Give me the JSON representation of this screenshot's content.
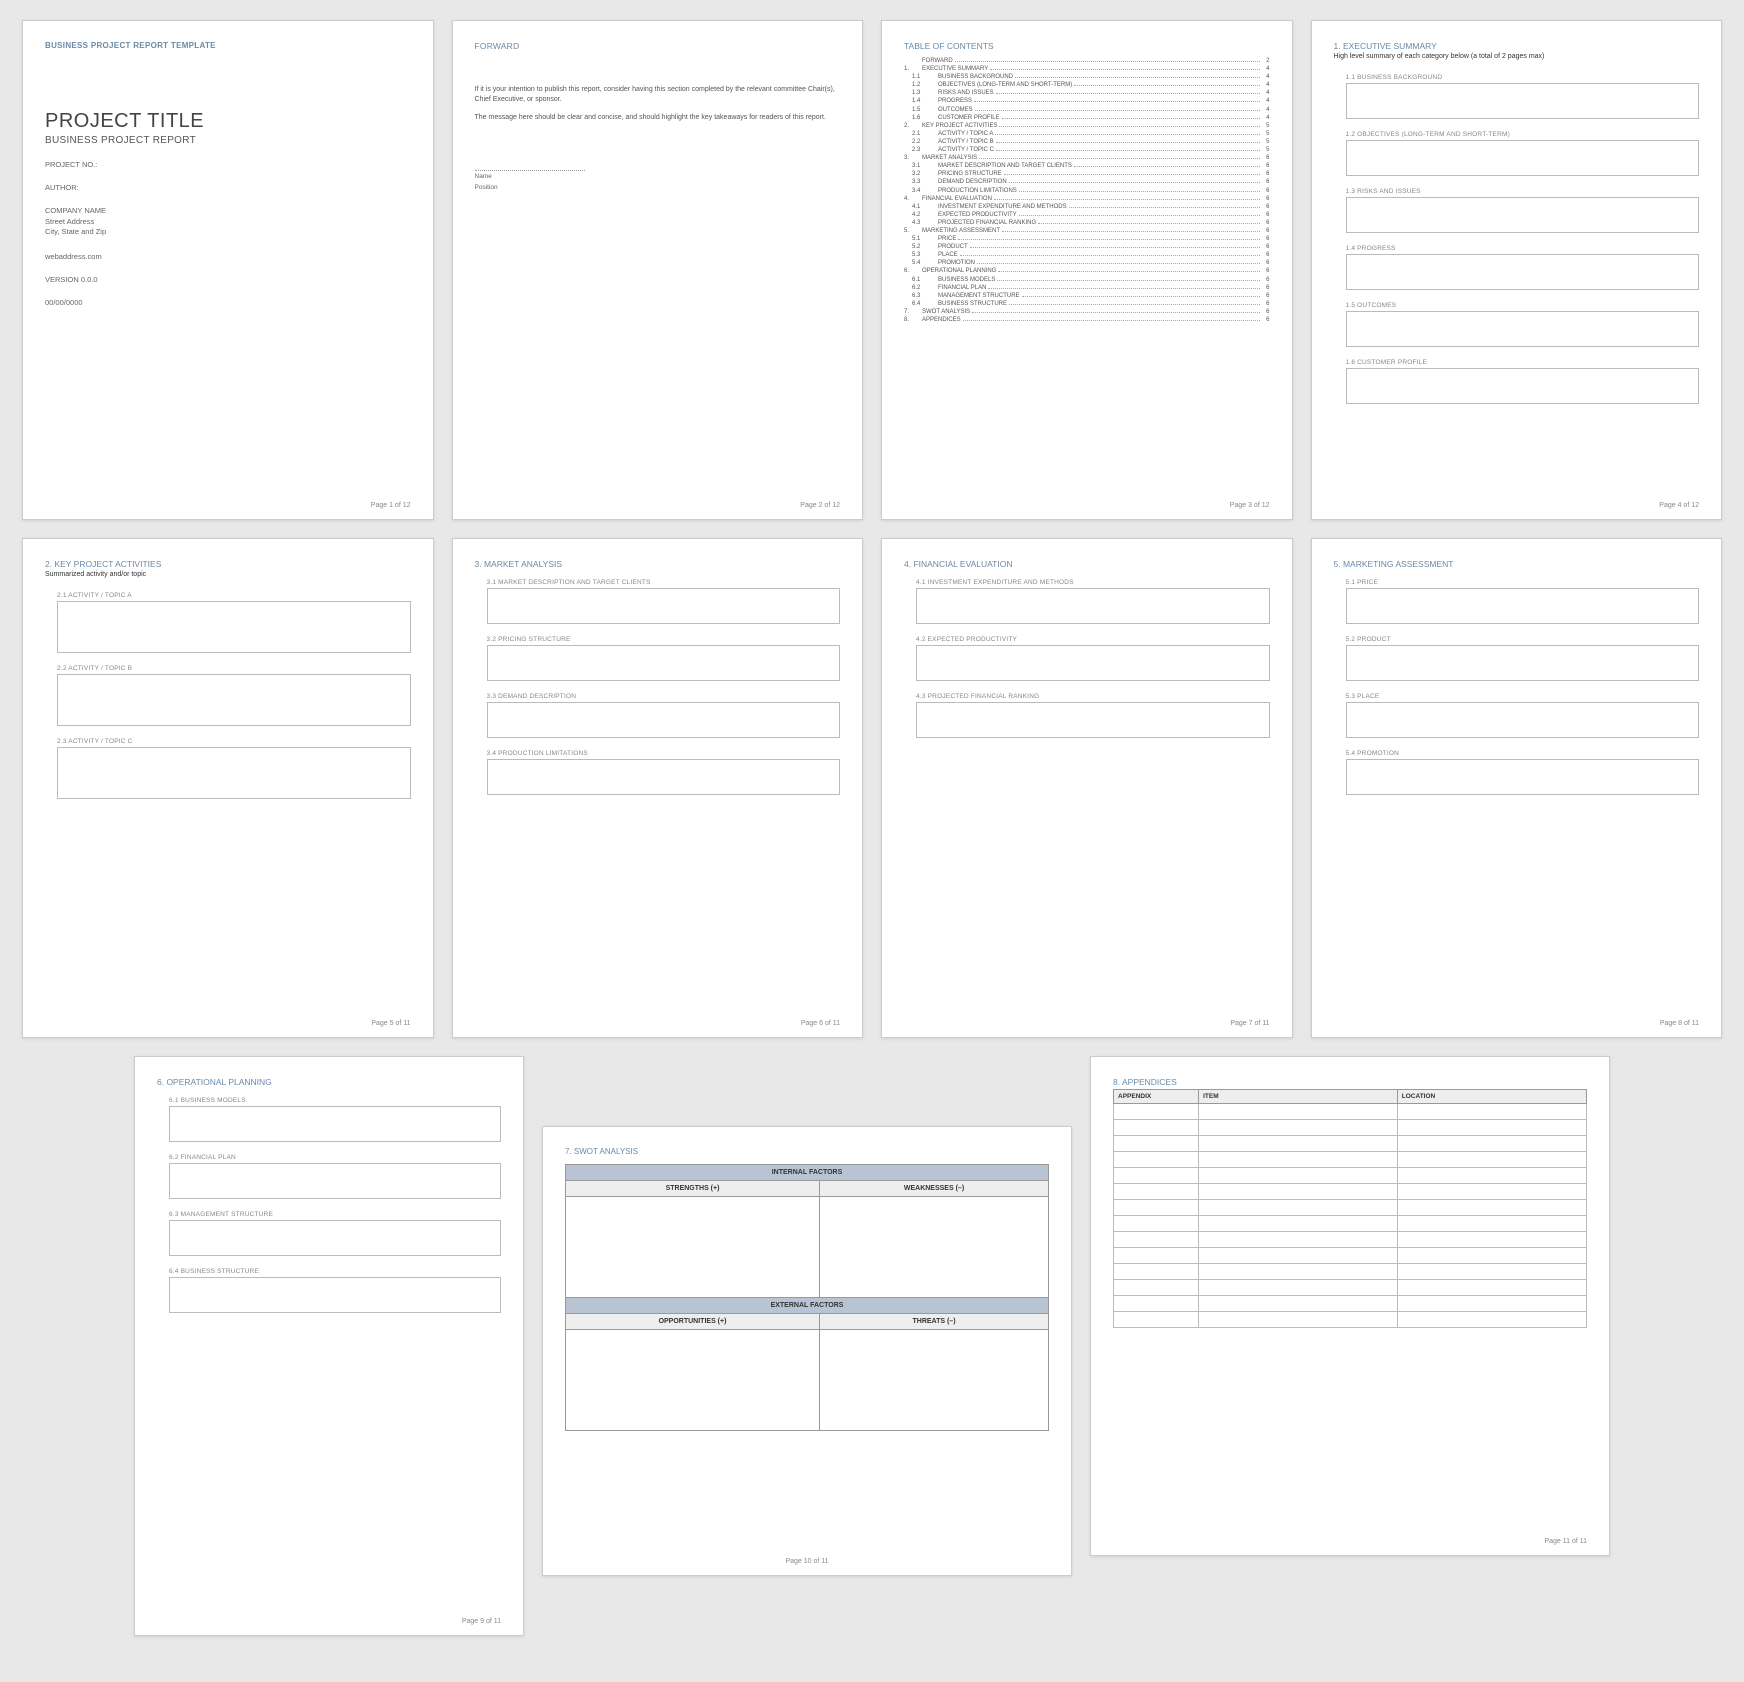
{
  "templateHeader": "BUSINESS PROJECT REPORT TEMPLATE",
  "cover": {
    "title": "PROJECT TITLE",
    "subtitle": "BUSINESS PROJECT REPORT",
    "projectNo": "PROJECT NO.:",
    "author": "AUTHOR:",
    "company": "COMPANY NAME",
    "street": "Street Address",
    "cityStateZip": "City, State and Zip",
    "web": "webaddress.com",
    "version": "VERSION 0.0.0",
    "date": "00/00/0000"
  },
  "forward": {
    "title": "FORWARD",
    "para1": "If it is your intention to publish this report, consider having this section completed by the relevant committee Chair(s), Chief Executive, or sponsor.",
    "para2": "The message here should be clear and concise, and should highlight the key takeaways for readers of this report.",
    "nameLabel": "Name",
    "positionLabel": "Position"
  },
  "toc": {
    "title": "TABLE OF CONTENTS",
    "items": [
      {
        "n": "",
        "t": "FORWARD",
        "p": "2",
        "sub": false
      },
      {
        "n": "1.",
        "t": "EXECUTIVE SUMMARY",
        "p": "4",
        "sub": false
      },
      {
        "n": "1.1",
        "t": "BUSINESS BACKGROUND",
        "p": "4",
        "sub": true
      },
      {
        "n": "1.2",
        "t": "OBJECTIVES (LONG-TERM AND SHORT-TERM)",
        "p": "4",
        "sub": true
      },
      {
        "n": "1.3",
        "t": "RISKS AND ISSUES",
        "p": "4",
        "sub": true
      },
      {
        "n": "1.4",
        "t": "PROGRESS",
        "p": "4",
        "sub": true
      },
      {
        "n": "1.5",
        "t": "OUTCOMES",
        "p": "4",
        "sub": true
      },
      {
        "n": "1.6",
        "t": "CUSTOMER PROFILE",
        "p": "4",
        "sub": true
      },
      {
        "n": "2.",
        "t": "KEY PROJECT ACTIVITIES",
        "p": "5",
        "sub": false
      },
      {
        "n": "2.1",
        "t": "ACTIVITY / TOPIC A",
        "p": "5",
        "sub": true
      },
      {
        "n": "2.2",
        "t": "ACTIVITY / TOPIC B",
        "p": "5",
        "sub": true
      },
      {
        "n": "2.3",
        "t": "ACTIVITY / TOPIC C",
        "p": "5",
        "sub": true
      },
      {
        "n": "3.",
        "t": "MARKET ANALYSIS",
        "p": "6",
        "sub": false
      },
      {
        "n": "3.1",
        "t": "MARKET DESCRIPTION AND TARGET CLIENTS",
        "p": "6",
        "sub": true
      },
      {
        "n": "3.2",
        "t": "PRICING STRUCTURE",
        "p": "6",
        "sub": true
      },
      {
        "n": "3.3",
        "t": "DEMAND DESCRIPTION",
        "p": "6",
        "sub": true
      },
      {
        "n": "3.4",
        "t": "PRODUCTION LIMITATIONS",
        "p": "6",
        "sub": true
      },
      {
        "n": "4.",
        "t": "FINANCIAL EVALUATION",
        "p": "6",
        "sub": false
      },
      {
        "n": "4.1",
        "t": "INVESTMENT EXPENDITURE AND METHODS",
        "p": "6",
        "sub": true
      },
      {
        "n": "4.2",
        "t": "EXPECTED PRODUCTIVITY",
        "p": "6",
        "sub": true
      },
      {
        "n": "4.3",
        "t": "PROJECTED FINANCIAL RANKING",
        "p": "6",
        "sub": true
      },
      {
        "n": "5.",
        "t": "MARKETING ASSESSMENT",
        "p": "6",
        "sub": false
      },
      {
        "n": "5.1",
        "t": "PRICE",
        "p": "6",
        "sub": true
      },
      {
        "n": "5.2",
        "t": "PRODUCT",
        "p": "6",
        "sub": true
      },
      {
        "n": "5.3",
        "t": "PLACE",
        "p": "6",
        "sub": true
      },
      {
        "n": "5.4",
        "t": "PROMOTION",
        "p": "6",
        "sub": true
      },
      {
        "n": "6.",
        "t": "OPERATIONAL PLANNING",
        "p": "6",
        "sub": false
      },
      {
        "n": "6.1",
        "t": "BUSINESS MODELS",
        "p": "6",
        "sub": true
      },
      {
        "n": "6.2",
        "t": "FINANCIAL PLAN",
        "p": "6",
        "sub": true
      },
      {
        "n": "6.3",
        "t": "MANAGEMENT STRUCTURE",
        "p": "6",
        "sub": true
      },
      {
        "n": "6.4",
        "t": "BUSINESS STRUCTURE",
        "p": "6",
        "sub": true
      },
      {
        "n": "7.",
        "t": "SWOT ANALYSIS",
        "p": "6",
        "sub": false
      },
      {
        "n": "8.",
        "t": "APPENDICES",
        "p": "6",
        "sub": false
      }
    ]
  },
  "exec": {
    "title": "1. EXECUTIVE SUMMARY",
    "desc": "High level summary of each category below (a total of 2 pages max)",
    "s1": "1.1   BUSINESS BACKGROUND",
    "s2": "1.2   OBJECTIVES (LONG-TERM AND SHORT-TERM)",
    "s3": "1.3   RISKS AND ISSUES",
    "s4": "1.4   PROGRESS",
    "s5": "1.5   OUTCOMES",
    "s6": "1.6   CUSTOMER PROFILE"
  },
  "key": {
    "title": "2. KEY PROJECT ACTIVITIES",
    "desc": "Summarized activity and/or topic",
    "s1": "2.1   ACTIVITY / TOPIC A",
    "s2": "2.2   ACTIVITY / TOPIC B",
    "s3": "2.3   ACTIVITY / TOPIC C"
  },
  "market": {
    "title": "3. MARKET ANALYSIS",
    "s1": "3.1   MARKET DESCRIPTION AND TARGET CLIENTS",
    "s2": "3.2   PRICING STRUCTURE",
    "s3": "3.3   DEMAND DESCRIPTION",
    "s4": "3.4   PRODUCTION LIMITATIONS"
  },
  "fin": {
    "title": "4. FINANCIAL EVALUATION",
    "s1": "4.1   INVESTMENT EXPENDITURE AND METHODS",
    "s2": "4.2   EXPECTED PRODUCTIVITY",
    "s3": "4.3   PROJECTED FINANCIAL RANKING"
  },
  "mkt": {
    "title": "5. MARKETING ASSESSMENT",
    "s1": "5.1   PRICE",
    "s2": "5.2   PRODUCT",
    "s3": "5.3   PLACE",
    "s4": "5.4   PROMOTION"
  },
  "ops": {
    "title": "6. OPERATIONAL PLANNING",
    "s1": "6.1   BUSINESS MODELS",
    "s2": "6.2   FINANCIAL PLAN",
    "s3": "6.3   MANAGEMENT STRUCTURE",
    "s4": "6.4   BUSINESS STRUCTURE"
  },
  "swot": {
    "title": "7. SWOT ANALYSIS",
    "internal": "INTERNAL FACTORS",
    "external": "EXTERNAL FACTORS",
    "strengths": "STRENGTHS (+)",
    "weaknesses": "WEAKNESSES (–)",
    "opportunities": "OPPORTUNITIES (+)",
    "threats": "THREATS (–)"
  },
  "apx": {
    "title": "8. APPENDICES",
    "col1": "APPENDIX",
    "col2": "ITEM",
    "col3": "LOCATION",
    "rows": 14
  },
  "footers": {
    "p1": "Page 1 of 12",
    "p2": "Page 2 of 12",
    "p3": "Page 3 of 12",
    "p4": "Page 4 of 12",
    "p5": "Page 5 of 11",
    "p6": "Page 6 of 11",
    "p7": "Page 7 of 11",
    "p8": "Page 8 of 11",
    "p9": "Page 9 of 11",
    "p10": "Page 10 of 11",
    "p11": "Page 11 of 11"
  }
}
